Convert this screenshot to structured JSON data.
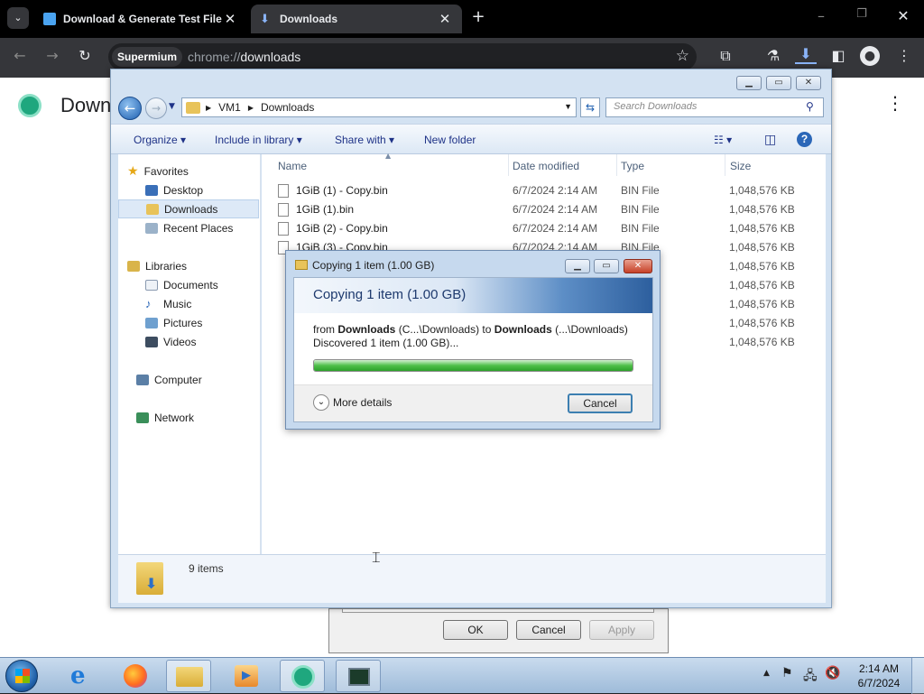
{
  "browser": {
    "tabs": [
      {
        "title": "Download & Generate Test File",
        "active": false
      },
      {
        "title": "Downloads",
        "active": true
      }
    ],
    "profile_label": "Supermium",
    "url_scheme": "chrome://",
    "url_path": "downloads",
    "page_title_fragment": "Downl"
  },
  "explorer": {
    "breadcrumb": [
      "VM1",
      "Downloads"
    ],
    "search_placeholder": "Search Downloads",
    "commands": {
      "organize": "Organize",
      "include_in_library": "Include in library",
      "share_with": "Share with",
      "new_folder": "New folder"
    },
    "nav": {
      "favorites": {
        "label": "Favorites",
        "items": [
          "Desktop",
          "Downloads",
          "Recent Places"
        ]
      },
      "libraries": {
        "label": "Libraries",
        "items": [
          "Documents",
          "Music",
          "Pictures",
          "Videos"
        ]
      },
      "computer": "Computer",
      "network": "Network"
    },
    "columns": [
      "Name",
      "Date modified",
      "Type",
      "Size"
    ],
    "files": [
      {
        "name": "1GiB (1) - Copy.bin",
        "date": "6/7/2024 2:14 AM",
        "type": "BIN File",
        "size": "1,048,576 KB"
      },
      {
        "name": "1GiB (1).bin",
        "date": "6/7/2024 2:14 AM",
        "type": "BIN File",
        "size": "1,048,576 KB"
      },
      {
        "name": "1GiB (2) - Copy.bin",
        "date": "6/7/2024 2:14 AM",
        "type": "BIN File",
        "size": "1,048,576 KB"
      },
      {
        "name": "1GiB (3) - Copy.bin",
        "date": "6/7/2024 2:14 AM",
        "type": "BIN File",
        "size": "1,048,576 KB"
      },
      {
        "name": "",
        "date": "",
        "type": "",
        "size": "1,048,576 KB"
      },
      {
        "name": "",
        "date": "",
        "type": "",
        "size": "1,048,576 KB"
      },
      {
        "name": "",
        "date": "",
        "type": "",
        "size": "1,048,576 KB"
      },
      {
        "name": "",
        "date": "",
        "type": "",
        "size": "1,048,576 KB"
      },
      {
        "name": "",
        "date": "",
        "type": "",
        "size": "1,048,576 KB"
      }
    ],
    "status_count": "9 items"
  },
  "copy_dialog": {
    "title": "Copying 1 item (1.00 GB)",
    "heading": "Copying 1 item (1.00 GB)",
    "from_label": "from",
    "from_bold": "Downloads",
    "from_path": "(C...\\Downloads)",
    "to_label": "to",
    "to_bold": "Downloads",
    "to_path": "(...\\Downloads)",
    "discovered": "Discovered 1 item (1.00 GB)...",
    "progress_percent": 100,
    "more_details": "More details",
    "cancel": "Cancel"
  },
  "background_dialog": {
    "ok": "OK",
    "cancel": "Cancel",
    "apply": "Apply"
  },
  "taskbar": {
    "time": "2:14 AM",
    "date": "6/7/2024"
  }
}
